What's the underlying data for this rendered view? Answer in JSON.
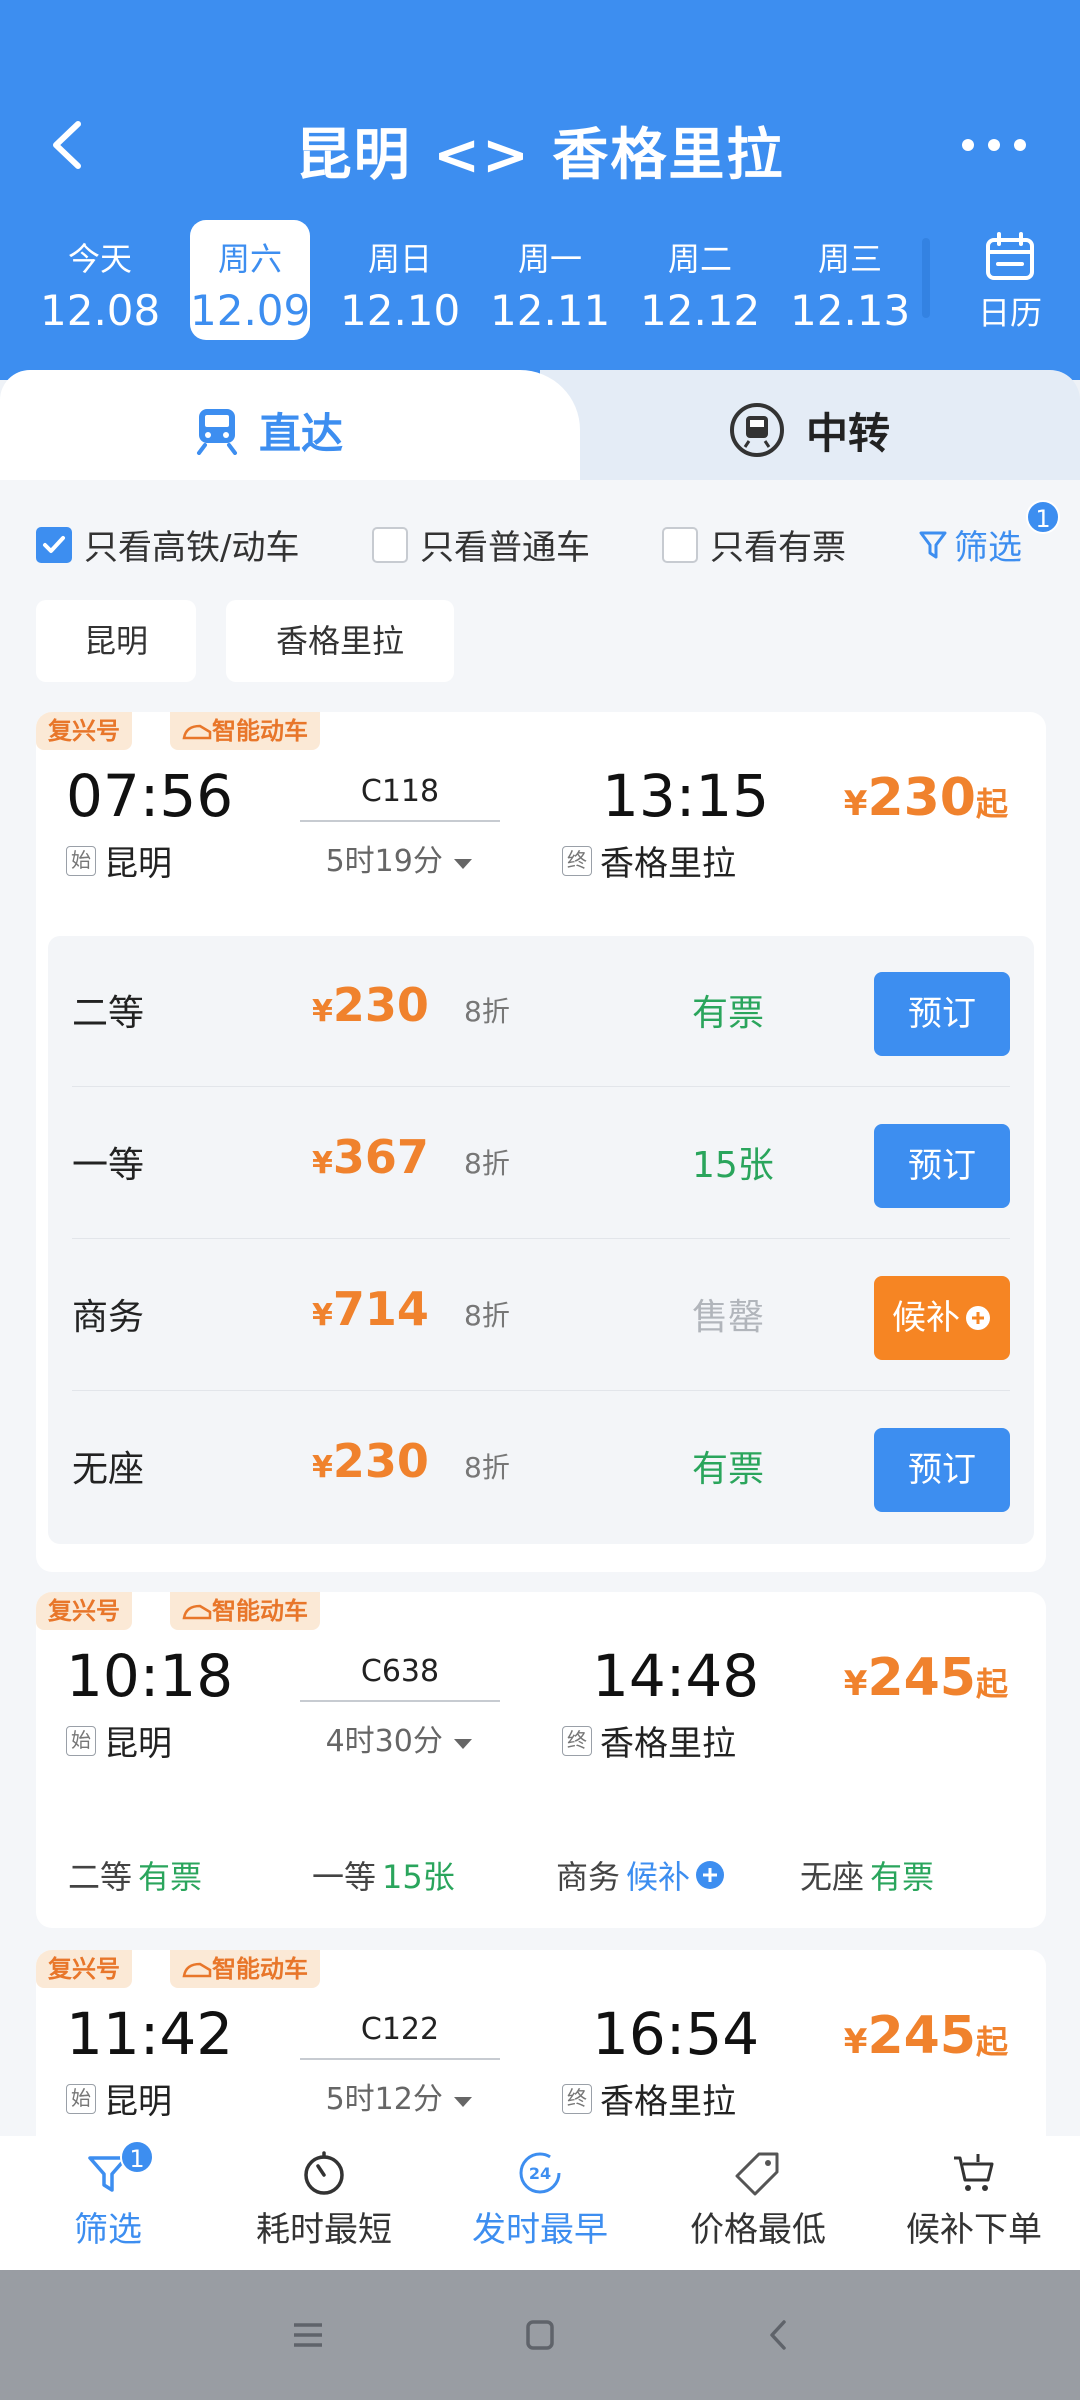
{
  "header": {
    "title": "昆明 <> 香格里拉"
  },
  "dates": [
    {
      "dow": "今天",
      "day": "12.08"
    },
    {
      "dow": "周六",
      "day": "12.09"
    },
    {
      "dow": "周日",
      "day": "12.10"
    },
    {
      "dow": "周一",
      "day": "12.11"
    },
    {
      "dow": "周二",
      "day": "12.12"
    },
    {
      "dow": "周三",
      "day": "12.13"
    }
  ],
  "calendar_label": "日历",
  "tabs": {
    "direct": "直达",
    "transfer": "中转"
  },
  "filters": {
    "high_speed": "只看高铁/动车",
    "normal": "只看普通车",
    "available": "只看有票",
    "filter_link": "筛选",
    "filter_count": "1"
  },
  "stations": {
    "from": "昆明",
    "to": "香格里拉"
  },
  "trains": [
    {
      "tag1": "复兴号",
      "tag2": "智能动车",
      "dep": "07:56",
      "arr": "13:15",
      "no": "C118",
      "duration": "5时19分",
      "from_mark": "始",
      "to_mark": "终",
      "from": "昆明",
      "to": "香格里拉",
      "price": "230",
      "price_suffix": "起",
      "seats": [
        {
          "name": "二等",
          "price": "230",
          "discount": "8折",
          "avail": "有票",
          "action": "预订"
        },
        {
          "name": "一等",
          "price": "367",
          "discount": "8折",
          "avail": "15张",
          "action": "预订"
        },
        {
          "name": "商务",
          "price": "714",
          "discount": "8折",
          "avail": "售罄",
          "action": "候补"
        },
        {
          "name": "无座",
          "price": "230",
          "discount": "8折",
          "avail": "有票",
          "action": "预订"
        }
      ]
    },
    {
      "tag1": "复兴号",
      "tag2": "智能动车",
      "dep": "10:18",
      "arr": "14:48",
      "no": "C638",
      "duration": "4时30分",
      "from_mark": "始",
      "to_mark": "终",
      "from": "昆明",
      "to": "香格里拉",
      "price": "245",
      "price_suffix": "起",
      "summary": [
        {
          "name": "二等",
          "value": "有票"
        },
        {
          "name": "一等",
          "value": "15张"
        },
        {
          "name": "商务",
          "value": "候补"
        },
        {
          "name": "无座",
          "value": "有票"
        }
      ]
    },
    {
      "tag1": "复兴号",
      "tag2": "智能动车",
      "dep": "11:42",
      "arr": "16:54",
      "no": "C122",
      "duration": "5时12分",
      "from_mark": "始",
      "to_mark": "终",
      "from": "昆明",
      "to": "香格里拉",
      "price": "245",
      "price_suffix": "起"
    }
  ],
  "yen": "¥",
  "bottom_bar": {
    "filter": "筛选",
    "filter_count": "1",
    "shortest": "耗时最短",
    "earliest": "发时最早",
    "earliest_icon_text": "24",
    "cheapest": "价格最低",
    "waitlist": "候补下单"
  },
  "colors": {
    "brand_blue": "#3d8ef0",
    "price_orange": "#f0822d",
    "available_green": "#2aa55c",
    "waitlist_orange": "#f68523"
  }
}
